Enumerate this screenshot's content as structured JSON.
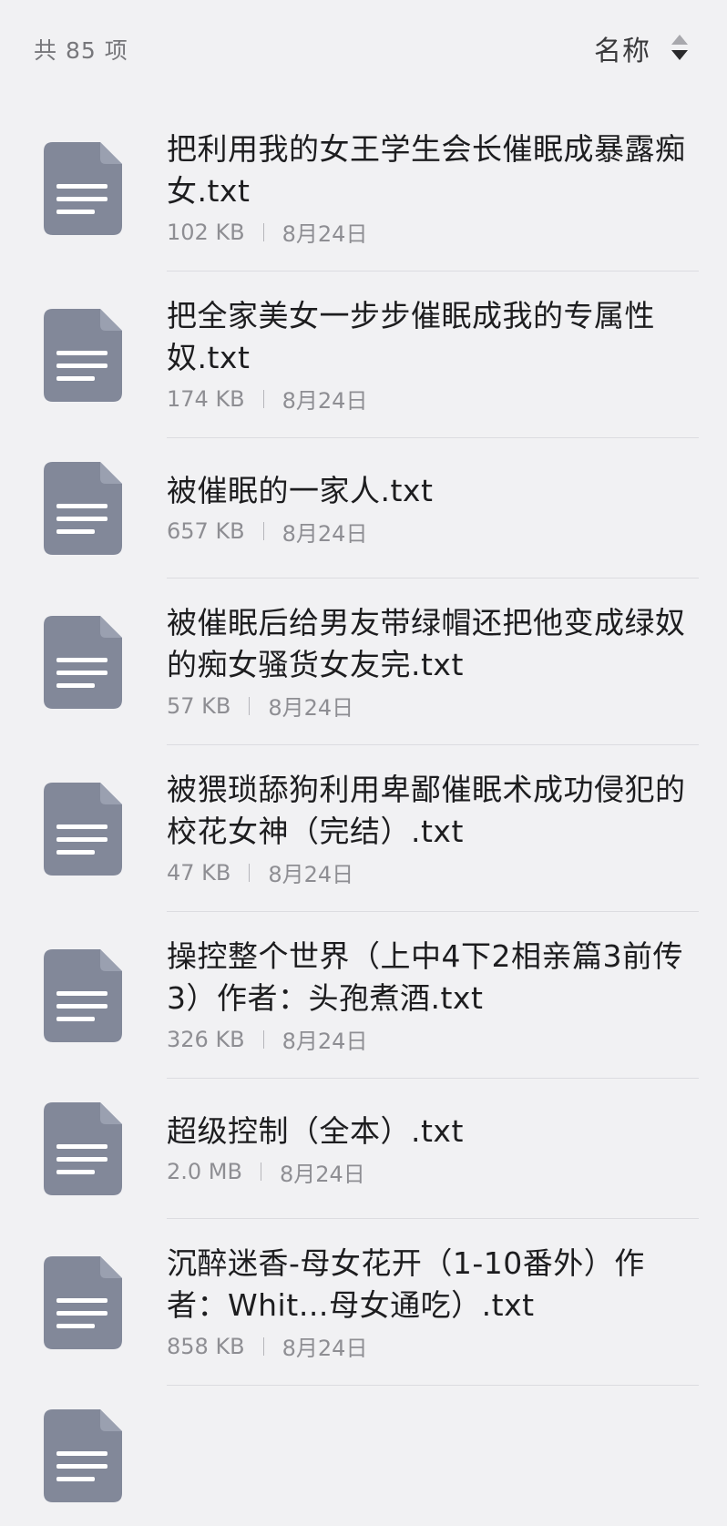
{
  "header": {
    "count_label": "共 85 项",
    "sort_label": "名称"
  },
  "files": [
    {
      "name": "把利用我的女王学生会长催眠成暴露痴女.txt",
      "size": "102 KB",
      "date": "8月24日",
      "icon": "text-file-icon"
    },
    {
      "name": "把全家美女一步步催眠成我的专属性奴.txt",
      "size": "174 KB",
      "date": "8月24日",
      "icon": "text-file-icon"
    },
    {
      "name": "被催眠的一家人.txt",
      "size": "657 KB",
      "date": "8月24日",
      "icon": "text-file-icon"
    },
    {
      "name": "被催眠后给男友带绿帽还把他变成绿奴的痴女骚货女友完.txt",
      "size": "57 KB",
      "date": "8月24日",
      "icon": "text-file-icon"
    },
    {
      "name": "被猥琐舔狗利用卑鄙催眠术成功侵犯的校花女神（完结）.txt",
      "size": "47 KB",
      "date": "8月24日",
      "icon": "text-file-icon"
    },
    {
      "name": "操控整个世界（上中4下2相亲篇3前传3）作者：头孢煮酒.txt",
      "size": "326 KB",
      "date": "8月24日",
      "icon": "text-file-icon"
    },
    {
      "name": "超级控制（全本）.txt",
      "size": "2.0 MB",
      "date": "8月24日",
      "icon": "text-file-icon"
    },
    {
      "name": "沉醉迷香-母女花开（1-10番外）作者：Whit…母女通吃）.txt",
      "size": "858 KB",
      "date": "8月24日",
      "icon": "text-file-icon"
    },
    {
      "name": "",
      "size": "",
      "date": "",
      "icon": "text-file-icon"
    }
  ],
  "colors": {
    "background": "#f1f1f3",
    "icon_fill": "#828899",
    "icon_lines": "#ffffff",
    "text_primary": "#1d1d1f",
    "text_secondary": "#8e8e93"
  }
}
